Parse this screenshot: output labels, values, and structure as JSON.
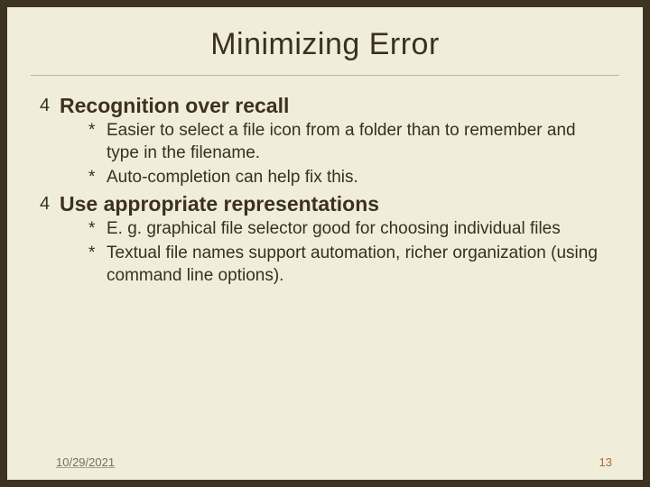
{
  "title": "Minimizing Error",
  "bullets": {
    "b1": {
      "marker": "4",
      "text": "Recognition over recall",
      "subs": {
        "s1": {
          "marker": "*",
          "text": "Easier to select a file icon from a folder than to remember and type in the filename."
        },
        "s2": {
          "marker": "*",
          "text": "Auto-completion can help fix this."
        }
      }
    },
    "b2": {
      "marker": "4",
      "text": "Use appropriate representations",
      "subs": {
        "s1": {
          "marker": "*",
          "text": "E. g. graphical file selector good for choosing individual files"
        },
        "s2": {
          "marker": "*",
          "text": "Textual file names support automation, richer organization (using command line options)."
        }
      }
    }
  },
  "footer": {
    "date": "10/29/2021",
    "page": "13"
  }
}
